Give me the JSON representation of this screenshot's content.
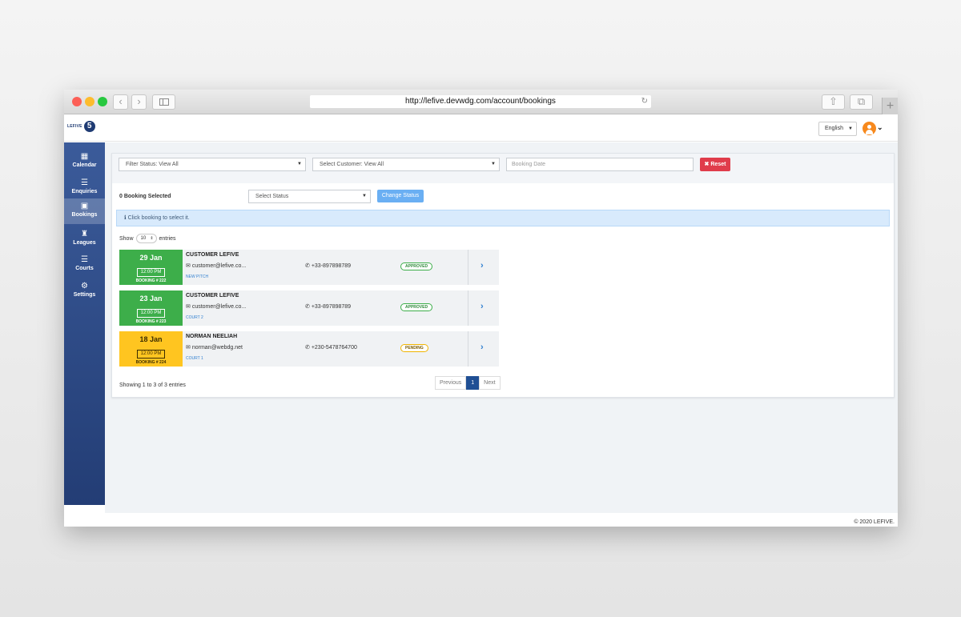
{
  "browser": {
    "url": "http://lefive.devwdg.com/account/bookings",
    "back_icon": "chevron-left",
    "forward_icon": "chevron-right",
    "new_tab_icon": "plus"
  },
  "header": {
    "logo_text": "LEFIVE",
    "logo_number": "5",
    "language": "English"
  },
  "sidebar": {
    "items": [
      {
        "label": "Calendar",
        "icon": "calendar-icon"
      },
      {
        "label": "Enquiries",
        "icon": "list-icon"
      },
      {
        "label": "Bookings",
        "icon": "calendar-check-icon",
        "active": true
      },
      {
        "label": "Leagues",
        "icon": "trophy-icon"
      },
      {
        "label": "Courts",
        "icon": "list-icon"
      },
      {
        "label": "Settings",
        "icon": "gear-icon"
      }
    ]
  },
  "filters": {
    "status": "Filter Status: View All",
    "customer": "Select Customer: View All",
    "date_placeholder": "Booking Date",
    "reset_label": "Reset"
  },
  "actions": {
    "selected_count": "0 Booking Selected",
    "select_status": "Select Status",
    "change_status": "Change Status"
  },
  "alert": {
    "text": "Click booking to select it."
  },
  "entries": {
    "show_label": "Show",
    "value": "10",
    "suffix": "entries"
  },
  "bookings": [
    {
      "date": "29 Jan",
      "time": "12:00 PM",
      "booking_no": "BOOKING # 222",
      "customer": "CUSTOMER LEFIVE",
      "email": "customer@lefive.co...",
      "phone": "+33-897898789",
      "status": "APPROVED",
      "court": "NEW PITCH",
      "color": "#3dae4a"
    },
    {
      "date": "23 Jan",
      "time": "12:00 PM",
      "booking_no": "BOOKING # 223",
      "customer": "CUSTOMER LEFIVE",
      "email": "customer@lefive.co...",
      "phone": "+33-897898789",
      "status": "APPROVED",
      "court": "COURT 2",
      "color": "#3dae4a"
    },
    {
      "date": "18 Jan",
      "time": "12:00 PM",
      "booking_no": "BOOKING # 224",
      "customer": "NORMAN NEELIAH",
      "email": "norman@webdg.net",
      "phone": "+230-5478764700",
      "status": "PENDING",
      "court": "COURT 1",
      "color": "#ffc520"
    }
  ],
  "pagination": {
    "info": "Showing 1 to 3 of 3 entries",
    "previous": "Previous",
    "current": "1",
    "next": "Next"
  },
  "footer": {
    "copyright": "© 2020 LEFIVE."
  }
}
